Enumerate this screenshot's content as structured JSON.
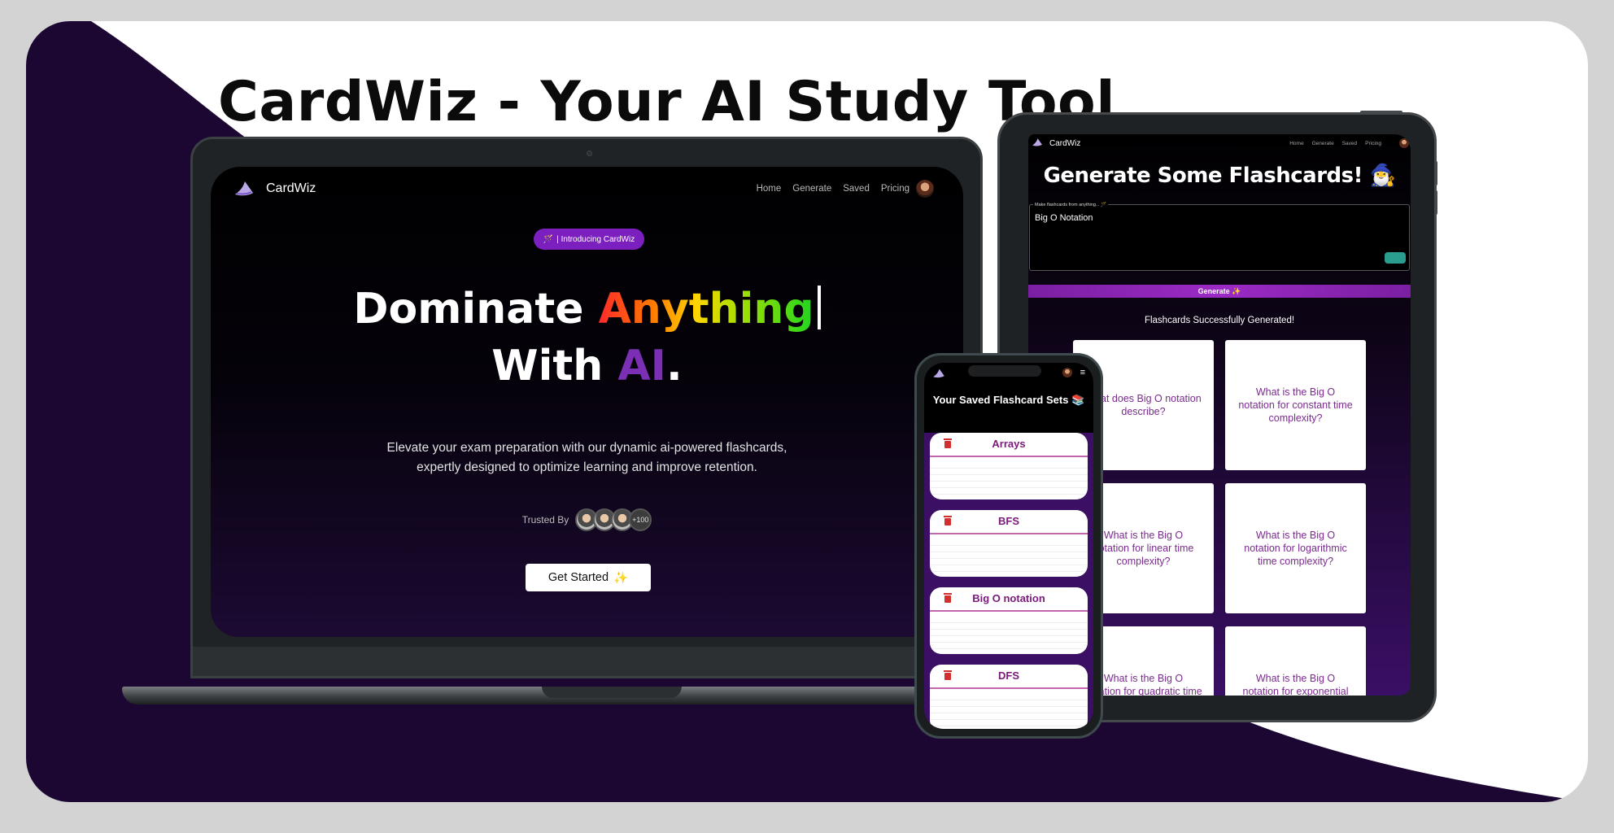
{
  "page_title": "CardWiz - Your AI Study Tool",
  "colors": {
    "background": "#d3d3d3",
    "card": "#ffffff",
    "wave": "#1c0733",
    "accent_purple": "#7c1fbf",
    "ai_purple": "#7a2fb5"
  },
  "laptop": {
    "brand": "CardWiz",
    "nav": {
      "home": "Home",
      "generate": "Generate",
      "saved": "Saved",
      "pricing": "Pricing"
    },
    "pill_icon": "🪄",
    "pill_label": "| Introducing CardWiz",
    "hero": {
      "word1": "Dominate ",
      "word2": "Anything",
      "line2_word1": "With ",
      "line2_word2": "AI",
      "line2_end": "."
    },
    "subtitle_line1": "Elevate your exam preparation with our dynamic ai-powered flashcards,",
    "subtitle_line2": "expertly designed to optimize learning and improve retention.",
    "trusted_label": "Trusted By",
    "trusted_more": "+100",
    "cta_label": "Get Started",
    "cta_icon": "✨"
  },
  "tablet": {
    "brand": "CardWiz",
    "nav": {
      "home": "Home",
      "generate": "Generate",
      "saved": "Saved",
      "pricing": "Pricing"
    },
    "title": "Generate Some Flashcards! 🧙‍♂️",
    "input_label": "Make flashcards from anything... 🪄",
    "input_value": "Big O Notation",
    "generate_label": "Generate ✨",
    "success_text": "Flashcards Successfully Generated!",
    "cards": [
      "What does Big O notation describe?",
      "What is the Big O notation for constant time complexity?",
      "What is the Big O notation for linear time complexity?",
      "What is the Big O notation for logarithmic time complexity?",
      "What is the Big O notation for quadratic time complexity?",
      "What is the Big O notation for exponential time complexity?"
    ]
  },
  "phone": {
    "title": "Your Saved Flashcard Sets 📚",
    "menu_icon": "≡",
    "sets": [
      "Arrays",
      "BFS",
      "Big O notation",
      "DFS"
    ]
  }
}
